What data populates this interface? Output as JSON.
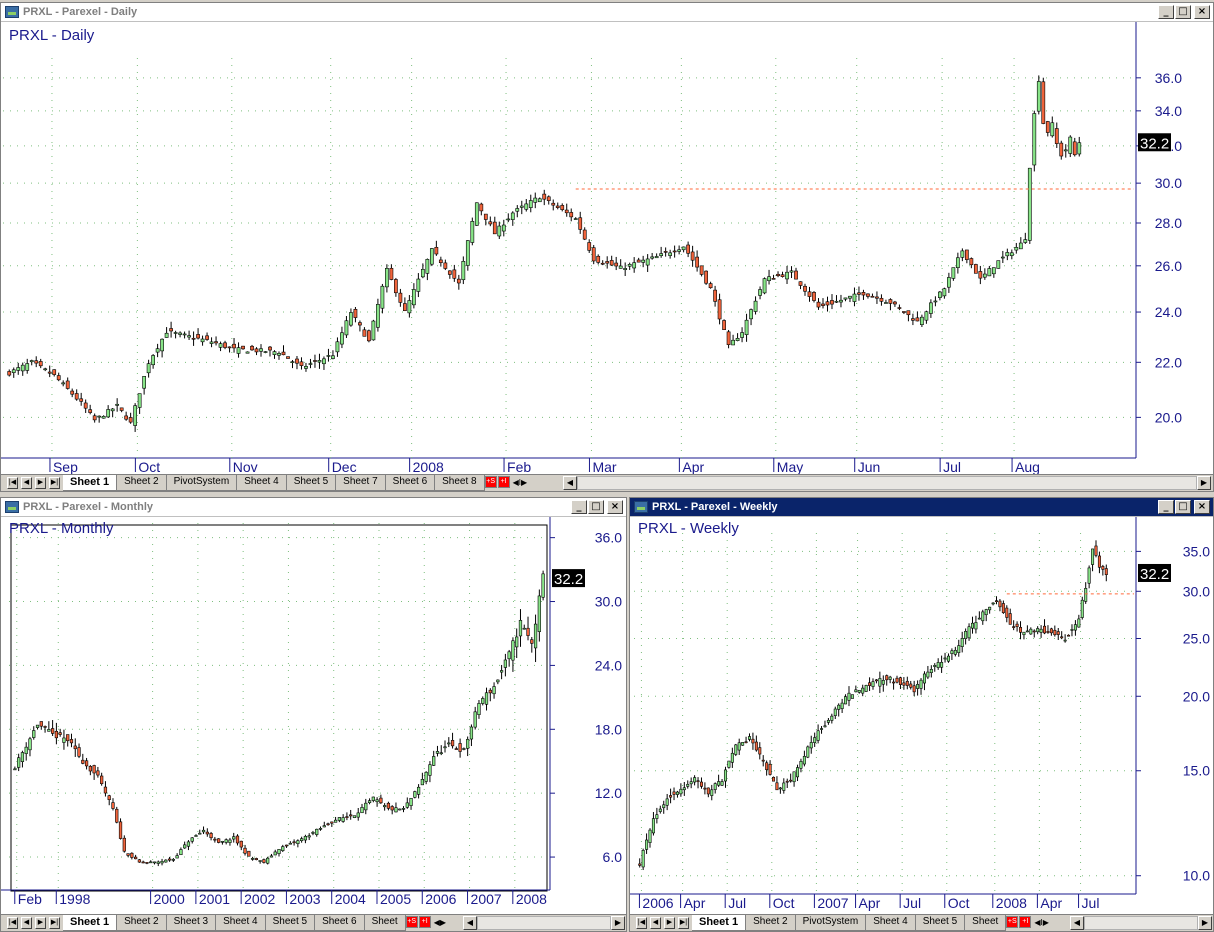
{
  "colors": {
    "up": "#88e488",
    "down": "#f0643c",
    "wick": "#000000",
    "axis": "#1a1a8c",
    "grid": "#7fbf7f",
    "level": "#ff6a3a",
    "title": "#1a1a8c",
    "last_bg": "#000000",
    "last_fg": "#ffffff"
  },
  "windows": {
    "daily": {
      "title": "PRXL - Parexel - Daily",
      "label": "PRXL - Daily",
      "active": false,
      "tabs": [
        "Sheet 1",
        "Sheet 2",
        "PivotSystem",
        "Sheet 4",
        "Sheet 5",
        "Sheet 7",
        "Sheet 6",
        "Sheet 8"
      ],
      "tab_nav": "I"
    },
    "monthly": {
      "title": "PRXL - Parexel - Monthly",
      "label": "PRXL - Monthly",
      "active": false,
      "tabs": [
        "Sheet 1",
        "Sheet 2",
        "Sheet 3",
        "Sheet 4",
        "Sheet 5",
        "Sheet 6",
        "Sheet"
      ],
      "tab_nav": ""
    },
    "weekly": {
      "title": "PRXL - Parexel - Weekly",
      "label": "PRXL - Weekly",
      "active": true,
      "tabs": [
        "Sheet 1",
        "Sheet 2",
        "PivotSystem",
        "Sheet 4",
        "Sheet 5",
        "Sheet"
      ],
      "tab_nav": "I"
    }
  },
  "chart_data": [
    {
      "type": "candlestick",
      "name": "daily",
      "title": "PRXL - Daily",
      "ylim": [
        19.0,
        37.0
      ],
      "yscale": "log",
      "yticks": [
        "20.0",
        "22.0",
        "24.0",
        "26.0",
        "28.0",
        "30.0",
        "32.0",
        "34.0",
        "36.0"
      ],
      "ytick_values": [
        20,
        22,
        24,
        26,
        28,
        30,
        32,
        34,
        36
      ],
      "xlabels": [
        "Sep",
        "Oct",
        "Nov",
        "Dec",
        "2008",
        "Feb",
        "Mar",
        "Apr",
        "May",
        "Jun",
        "Jul",
        "Aug"
      ],
      "xlabel_bars": [
        10,
        29,
        50,
        72,
        90,
        111,
        130,
        150,
        171,
        189,
        208,
        224
      ],
      "last_price": "32.2",
      "last_value": 32.2,
      "level_line": {
        "value": 29.7,
        "from_bar": 126
      },
      "num_bars": 240,
      "anchors": [
        [
          0,
          21.6
        ],
        [
          5,
          22.0
        ],
        [
          10,
          21.5
        ],
        [
          16,
          20.5
        ],
        [
          19,
          19.9
        ],
        [
          24,
          20.4
        ],
        [
          27,
          19.8
        ],
        [
          31,
          22.0
        ],
        [
          35,
          23.2
        ],
        [
          45,
          22.8
        ],
        [
          50,
          22.5
        ],
        [
          60,
          22.4
        ],
        [
          65,
          21.8
        ],
        [
          72,
          22.3
        ],
        [
          76,
          24.0
        ],
        [
          80,
          22.8
        ],
        [
          84,
          25.8
        ],
        [
          88,
          24.0
        ],
        [
          94,
          26.7
        ],
        [
          100,
          25.2
        ],
        [
          104,
          29.0
        ],
        [
          108,
          27.5
        ],
        [
          112,
          28.5
        ],
        [
          118,
          29.3
        ],
        [
          126,
          28.2
        ],
        [
          130,
          26.3
        ],
        [
          136,
          25.9
        ],
        [
          144,
          26.4
        ],
        [
          150,
          26.9
        ],
        [
          156,
          25.0
        ],
        [
          160,
          22.6
        ],
        [
          163,
          23.2
        ],
        [
          168,
          25.4
        ],
        [
          174,
          25.7
        ],
        [
          180,
          24.2
        ],
        [
          190,
          24.8
        ],
        [
          196,
          24.4
        ],
        [
          202,
          23.6
        ],
        [
          208,
          25.0
        ],
        [
          212,
          26.7
        ],
        [
          216,
          25.4
        ],
        [
          220,
          26.2
        ],
        [
          225,
          27.0
        ],
        [
          230,
          29.3
        ],
        [
          234,
          28.6
        ],
        [
          236,
          29.2
        ],
        [
          226,
          27.3
        ]
      ],
      "gap_after": 236,
      "tail": [
        [
          227,
          30.9
        ],
        [
          228,
          33.8
        ],
        [
          229,
          35.9
        ],
        [
          230,
          33.3
        ],
        [
          231,
          32.8
        ],
        [
          232,
          33.2
        ],
        [
          233,
          32.1
        ],
        [
          234,
          31.5
        ],
        [
          235,
          31.8
        ],
        [
          236,
          32.4
        ],
        [
          237,
          31.5
        ],
        [
          238,
          32.2
        ]
      ]
    },
    {
      "type": "candlestick",
      "name": "monthly",
      "title": "PRXL - Monthly",
      "ylim": [
        3.0,
        37.0
      ],
      "yscale": "linear",
      "yticks": [
        "6.0",
        "12.0",
        "18.0",
        "24.0",
        "30.0",
        "36.0"
      ],
      "ytick_values": [
        6,
        12,
        18,
        24,
        30,
        36
      ],
      "xlabels": [
        "Feb",
        "1998",
        "2000",
        "2001",
        "2002",
        "2003",
        "2004",
        "2005",
        "2006",
        "2007",
        "2008"
      ],
      "xlabel_bars": [
        1,
        12,
        37,
        49,
        61,
        73,
        85,
        97,
        109,
        121,
        133
      ],
      "last_price": "32.2",
      "last_value": 32.2,
      "num_bars": 141,
      "anchors": [
        [
          0,
          14.5
        ],
        [
          3,
          16.5
        ],
        [
          6,
          18.5
        ],
        [
          10,
          17.5
        ],
        [
          14,
          17.0
        ],
        [
          18,
          15.0
        ],
        [
          22,
          13.5
        ],
        [
          26,
          10.5
        ],
        [
          29,
          6.5
        ],
        [
          33,
          5.5
        ],
        [
          37,
          5.5
        ],
        [
          42,
          5.8
        ],
        [
          46,
          7.5
        ],
        [
          50,
          8.5
        ],
        [
          54,
          7.3
        ],
        [
          58,
          7.8
        ],
        [
          62,
          6.0
        ],
        [
          66,
          5.5
        ],
        [
          70,
          6.8
        ],
        [
          75,
          7.5
        ],
        [
          80,
          8.5
        ],
        [
          85,
          9.5
        ],
        [
          90,
          10.0
        ],
        [
          95,
          11.5
        ],
        [
          99,
          10.5
        ],
        [
          103,
          10.5
        ],
        [
          107,
          12.5
        ],
        [
          111,
          15.5
        ],
        [
          115,
          16.5
        ],
        [
          119,
          16.0
        ],
        [
          123,
          20.5
        ],
        [
          127,
          22.0
        ],
        [
          131,
          25.0
        ],
        [
          134,
          28.0
        ],
        [
          137,
          26.0
        ],
        [
          140,
          32.2
        ]
      ]
    },
    {
      "type": "candlestick",
      "name": "weekly",
      "title": "PRXL - Weekly",
      "ylim": [
        9.5,
        37.0
      ],
      "yscale": "log",
      "yticks": [
        "10.0",
        "15.0",
        "20.0",
        "25.0",
        "30.0",
        "35.0"
      ],
      "ytick_values": [
        10,
        15,
        20,
        25,
        30,
        35
      ],
      "xlabels": [
        "2006",
        "Apr",
        "Jul",
        "Oct",
        "2007",
        "Apr",
        "Jul",
        "Oct",
        "2008",
        "Apr",
        "Jul"
      ],
      "xlabel_bars": [
        1,
        13,
        26,
        39,
        52,
        64,
        77,
        90,
        104,
        117,
        129
      ],
      "last_price": "32.2",
      "last_value": 32.2,
      "level_line": {
        "value": 29.7,
        "from_bar": 107
      },
      "num_bars": 137,
      "anchors": [
        [
          0,
          10.5
        ],
        [
          4,
          12.5
        ],
        [
          8,
          13.5
        ],
        [
          12,
          14.0
        ],
        [
          16,
          14.5
        ],
        [
          20,
          13.8
        ],
        [
          24,
          14.5
        ],
        [
          28,
          16.5
        ],
        [
          32,
          17.0
        ],
        [
          36,
          15.5
        ],
        [
          40,
          14.0
        ],
        [
          44,
          14.5
        ],
        [
          48,
          16.0
        ],
        [
          52,
          17.5
        ],
        [
          56,
          18.5
        ],
        [
          60,
          20.0
        ],
        [
          64,
          20.5
        ],
        [
          68,
          21.0
        ],
        [
          72,
          21.5
        ],
        [
          76,
          21.0
        ],
        [
          80,
          20.5
        ],
        [
          84,
          22.0
        ],
        [
          88,
          23.0
        ],
        [
          92,
          24.0
        ],
        [
          96,
          26.0
        ],
        [
          100,
          27.5
        ],
        [
          104,
          29.0
        ],
        [
          108,
          26.5
        ],
        [
          112,
          25.5
        ],
        [
          116,
          26.0
        ],
        [
          120,
          25.5
        ],
        [
          124,
          25.0
        ],
        [
          128,
          27.0
        ],
        [
          130,
          30.5
        ],
        [
          132,
          35.5
        ],
        [
          134,
          33.0
        ],
        [
          136,
          32.2
        ]
      ]
    }
  ]
}
